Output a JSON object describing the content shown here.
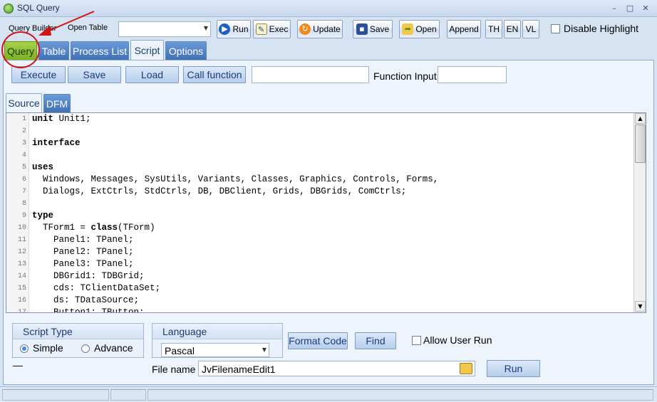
{
  "window": {
    "title": "SQL Query",
    "controls": [
      "–",
      "□",
      "✕"
    ]
  },
  "toolbar": {
    "query_builder": "Query Builder",
    "open_table": "Open Table",
    "run": "Run",
    "exec": "Exec",
    "update": "Update",
    "save": "Save",
    "open": "Open",
    "append": "Append",
    "th": "TH",
    "en": "EN",
    "vl": "VL",
    "disable_highlight": "Disable Highlight"
  },
  "tabs": [
    "Query",
    "Table",
    "Process List",
    "Script",
    "Options"
  ],
  "script_bar": {
    "execute": "Execute",
    "save": "Save",
    "load": "Load",
    "call_function": "Call function",
    "function_input": "Function Input"
  },
  "editor_tabs": [
    "Source",
    "DFM"
  ],
  "code_lines": [
    {
      "n": "1",
      "text": "unit Unit1;"
    },
    {
      "n": "2",
      "text": ""
    },
    {
      "n": "3",
      "text": "interface"
    },
    {
      "n": "4",
      "text": ""
    },
    {
      "n": "5",
      "text": "uses"
    },
    {
      "n": "6",
      "text": "  Windows, Messages, SysUtils, Variants, Classes, Graphics, Controls, Forms,"
    },
    {
      "n": "7",
      "text": "  Dialogs, ExtCtrls, StdCtrls, DB, DBClient, Grids, DBGrids, ComCtrls;"
    },
    {
      "n": "8",
      "text": ""
    },
    {
      "n": "9",
      "text": "type"
    },
    {
      "n": "10",
      "text": "  TForm1 = class(TForm)"
    },
    {
      "n": "11",
      "text": "    Panel1: TPanel;"
    },
    {
      "n": "12",
      "text": "    Panel2: TPanel;"
    },
    {
      "n": "13",
      "text": "    Panel3: TPanel;"
    },
    {
      "n": "14",
      "text": "    DBGrid1: TDBGrid;"
    },
    {
      "n": "15",
      "text": "    cds: TClientDataSet;"
    },
    {
      "n": "16",
      "text": "    ds: TDataSource;"
    },
    {
      "n": "17",
      "text": "    Button1: TButton;"
    }
  ],
  "bottom": {
    "script_type": "Script Type",
    "simple": "Simple",
    "advance": "Advance",
    "language": "Language",
    "language_value": "Pascal",
    "format_code": "Format Code",
    "find": "Find",
    "allow_user_run": "Allow User Run",
    "file_name_label": "File name",
    "file_name_value": "JvFilenameEdit1",
    "run": "Run",
    "dash": "—"
  },
  "colors": {
    "tab_blue": "#3f70b6",
    "query_tab_green": "#7bb122",
    "annotation_red": "#d21414"
  }
}
